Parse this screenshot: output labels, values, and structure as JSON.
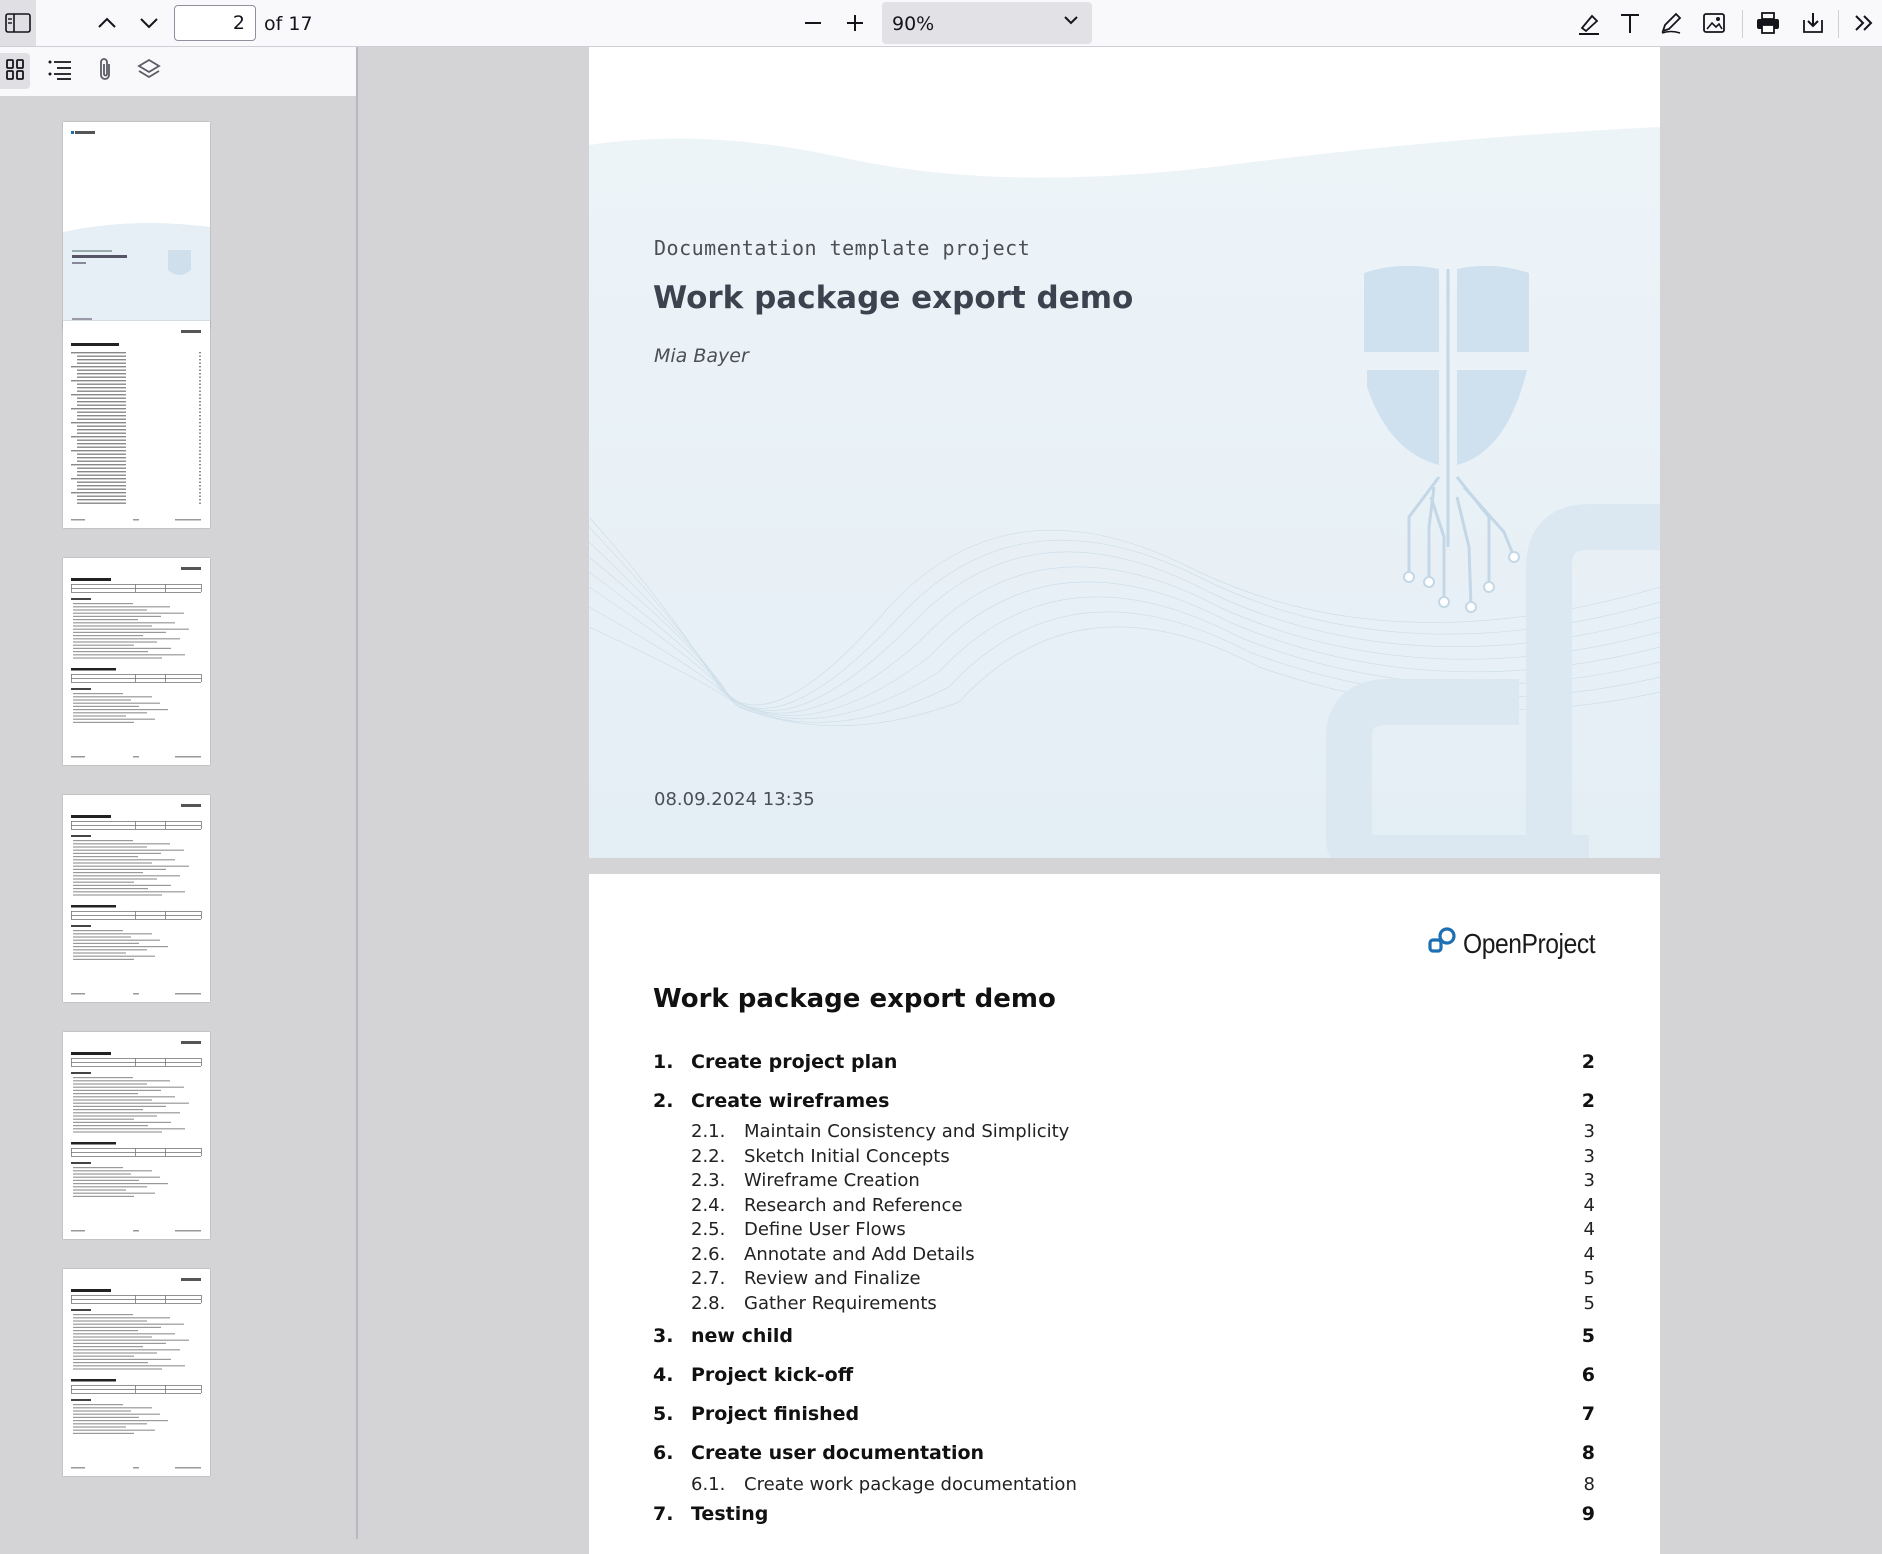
{
  "toolbar": {
    "page_current": "2",
    "page_total_label": "of 17",
    "zoom_value": "90%"
  },
  "sidebar": {
    "tools": [
      "thumbnails-icon",
      "outline-icon",
      "attachments-icon",
      "layers-icon"
    ],
    "thumbnail_count": 6,
    "selected_thumbnail": 2
  },
  "cover": {
    "subtitle": "Documentation template project",
    "title": "Work package export demo",
    "author": "Mia Bayer",
    "date": "08.09.2024 13:35"
  },
  "toc": {
    "logo_text": "OpenProject",
    "title": "Work package export demo",
    "entries": [
      {
        "num": "1.",
        "label": "Create project plan",
        "page": "2",
        "level": 1
      },
      {
        "num": "2.",
        "label": "Create wireframes",
        "page": "2",
        "level": 1
      },
      {
        "num": "2.1.",
        "label": "Maintain Consistency and Simplicity",
        "page": "3",
        "level": 2
      },
      {
        "num": "2.2.",
        "label": "Sketch Initial Concepts",
        "page": "3",
        "level": 2
      },
      {
        "num": "2.3.",
        "label": "Wireframe Creation",
        "page": "3",
        "level": 2
      },
      {
        "num": "2.4.",
        "label": "Research and Reference",
        "page": "4",
        "level": 2
      },
      {
        "num": "2.5.",
        "label": "Define User Flows",
        "page": "4",
        "level": 2
      },
      {
        "num": "2.6.",
        "label": "Annotate and Add Details",
        "page": "4",
        "level": 2
      },
      {
        "num": "2.7.",
        "label": "Review and Finalize",
        "page": "5",
        "level": 2
      },
      {
        "num": "2.8.",
        "label": "Gather Requirements",
        "page": "5",
        "level": 2
      },
      {
        "num": "3.",
        "label": "new child",
        "page": "5",
        "level": 1
      },
      {
        "num": "4.",
        "label": "Project kick-off",
        "page": "6",
        "level": 1
      },
      {
        "num": "5.",
        "label": "Project finished",
        "page": "7",
        "level": 1
      },
      {
        "num": "6.",
        "label": "Create user documentation",
        "page": "8",
        "level": 1
      },
      {
        "num": "6.1.",
        "label": "Create work package documentation",
        "page": "8",
        "level": 2
      },
      {
        "num": "7.",
        "label": "Testing",
        "page": "9",
        "level": 1
      }
    ]
  },
  "colors": {
    "toolbar_bg": "#f9f9fb",
    "viewer_bg": "#d4d4d7",
    "cover_tint": "#e8f1f7",
    "cover_title": "#3b434e"
  }
}
